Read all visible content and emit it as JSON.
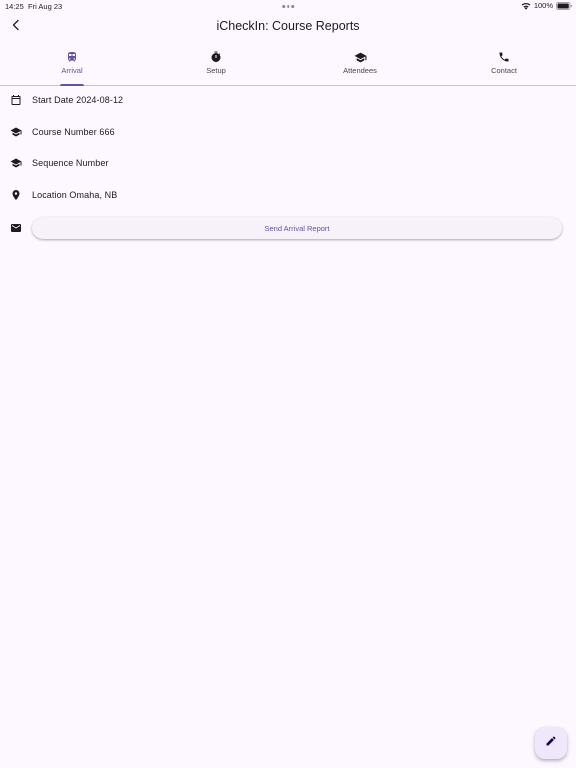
{
  "status_bar": {
    "time": "14:25",
    "date": "Fri Aug 23",
    "battery": "100%",
    "icons": [
      "wifi-icon",
      "battery-icon"
    ]
  },
  "app_bar": {
    "title": "iCheckIn: Course Reports",
    "back_icon": "back-arrow-icon"
  },
  "tabs": [
    {
      "label": "Arrival",
      "icon": "train-icon",
      "active": true
    },
    {
      "label": "Setup",
      "icon": "timer-icon",
      "active": false
    },
    {
      "label": "Attendees",
      "icon": "school-icon",
      "active": false
    },
    {
      "label": "Contact",
      "icon": "phone-icon",
      "active": false
    }
  ],
  "details": {
    "start_date": "Start Date 2024-08-12",
    "course_number": "Course Number 666",
    "sequence_number": "Sequence Number",
    "location": "Location Omaha, NB"
  },
  "actions": {
    "send_arrival_report": "Send Arrival Report"
  },
  "fab": {
    "icon": "edit-icon"
  },
  "colors": {
    "background": "#fdf7ff",
    "accent": "#6750a4",
    "text": "#1d1b20",
    "icon": "#1d1b20",
    "fab_bg": "#efe7fb"
  }
}
